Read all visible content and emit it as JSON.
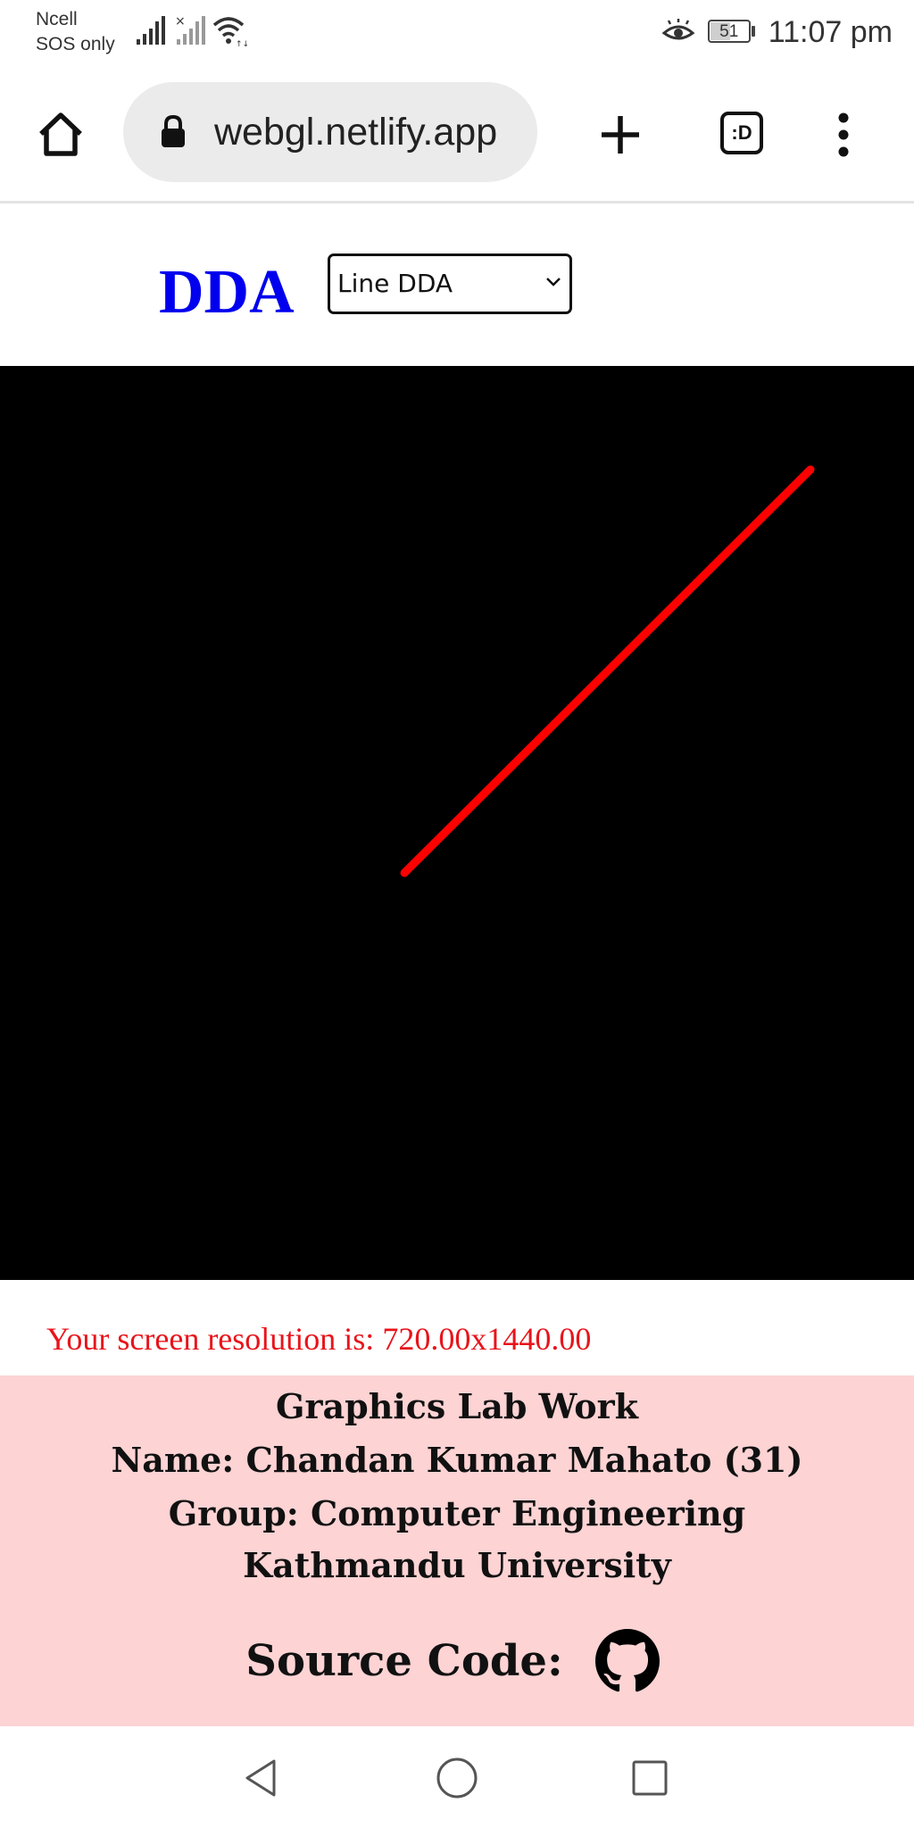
{
  "status_bar": {
    "carrier_line1": "Ncell",
    "carrier_line2": "SOS only",
    "battery_level": "51",
    "time": "11:07 pm",
    "icons": [
      "signal-icon",
      "no-signal-icon",
      "wifi-icon",
      "eye-comfort-icon",
      "battery-icon"
    ]
  },
  "browser": {
    "url": "webgl.netlify.app",
    "tabs_icon_text": ":D",
    "icons": [
      "home-icon",
      "lock-icon",
      "plus-icon",
      "tabs-icon",
      "more-vert-icon"
    ]
  },
  "header": {
    "title": "DDA",
    "select_value": "Line DDA",
    "title_color": "#0000ee"
  },
  "canvas": {
    "background": "#000000",
    "line_color": "#ff0000"
  },
  "resolution_text": "Your screen resolution is: 720.00x1440.00",
  "footer": {
    "line1": "Graphics Lab Work",
    "line2": "Name: Chandan Kumar Mahato (31)",
    "line3": "Group: Computer Engineering",
    "line4": "Kathmandu University",
    "source_label": "Source Code:",
    "background": "#fdd3d4",
    "icons": [
      "github-icon"
    ]
  },
  "navbar": {
    "icons": [
      "back-icon",
      "home-circle-icon",
      "recents-icon"
    ]
  }
}
